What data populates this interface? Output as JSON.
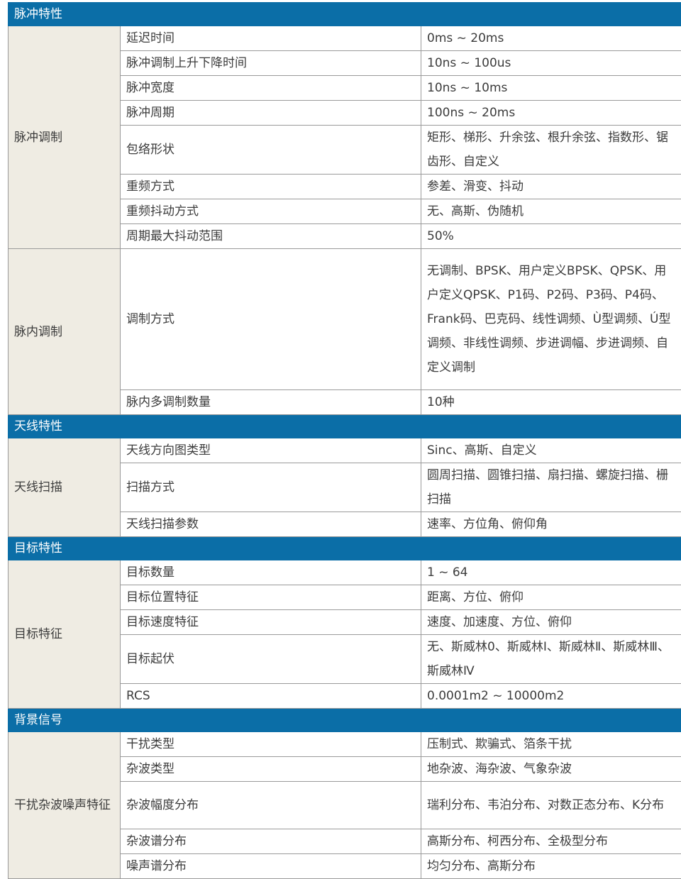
{
  "sections": [
    {
      "title": "脉冲特性",
      "groups": [
        {
          "name": "脉冲调制",
          "rows": [
            {
              "param": "延迟时间",
              "value": "0ms ~ 20ms"
            },
            {
              "param": "脉冲调制上升下降时间",
              "value": "10ns ~ 100us"
            },
            {
              "param": "脉冲宽度",
              "value": "10ns ~ 10ms"
            },
            {
              "param": "脉冲周期",
              "value": "100ns ~ 20ms"
            },
            {
              "param": "包络形状",
              "value": "矩形、梯形、升余弦、根升余弦、指数形、锯齿形、自定义"
            },
            {
              "param": "重频方式",
              "value": "参差、滑变、抖动"
            },
            {
              "param": "重频抖动方式",
              "value": "无、高斯、伪随机"
            },
            {
              "param": "周期最大抖动范围",
              "value": "50%"
            }
          ]
        },
        {
          "name": "脉内调制",
          "rows": [
            {
              "param": "调制方式",
              "value": "无调制、BPSK、用户定义BPSK、QPSK、用户定义QPSK、P1码、P2码、P3码、P4码、Frank码、巴克码、线性调频、Ù型调频、Ú型调频、非线性调频、步进调幅、步进调频、自定义调制"
            },
            {
              "param": "脉内多调制数量",
              "value": "10种"
            }
          ]
        }
      ]
    },
    {
      "title": "天线特性",
      "groups": [
        {
          "name": "天线扫描",
          "rows": [
            {
              "param": "天线方向图类型",
              "value": "Sinc、高斯、自定义"
            },
            {
              "param": "扫描方式",
              "value": "圆周扫描、圆锥扫描、扇扫描、螺旋扫描、栅扫描"
            },
            {
              "param": "天线扫描参数",
              "value": "速率、方位角、俯仰角"
            }
          ]
        }
      ]
    },
    {
      "title": "目标特性",
      "groups": [
        {
          "name": "目标特征",
          "rows": [
            {
              "param": "目标数量",
              "value": "1 ~ 64"
            },
            {
              "param": "目标位置特征",
              "value": "距离、方位、俯仰"
            },
            {
              "param": "目标速度特征",
              "value": "速度、加速度、方位、俯仰"
            },
            {
              "param": "目标起伏",
              "value": "无、斯威林0、斯威林Ⅰ、斯威林Ⅱ、斯威林Ⅲ、斯威林Ⅳ"
            },
            {
              "param": "RCS",
              "value": "0.0001m2 ~ 10000m2"
            }
          ]
        }
      ]
    },
    {
      "title": "背景信号",
      "groups": [
        {
          "name": "干扰杂波噪声特征",
          "rows": [
            {
              "param": "干扰类型",
              "value": "压制式、欺骗式、箔条干扰"
            },
            {
              "param": "杂波类型",
              "value": "地杂波、海杂波、气象杂波"
            },
            {
              "param": "杂波幅度分布",
              "value": "瑞利分布、韦泊分布、对数正态分布、K分布"
            },
            {
              "param": "杂波谱分布",
              "value": "高斯分布、柯西分布、全极型分布"
            },
            {
              "param": "噪声谱分布",
              "value": "均匀分布、高斯分布"
            }
          ]
        }
      ]
    }
  ]
}
